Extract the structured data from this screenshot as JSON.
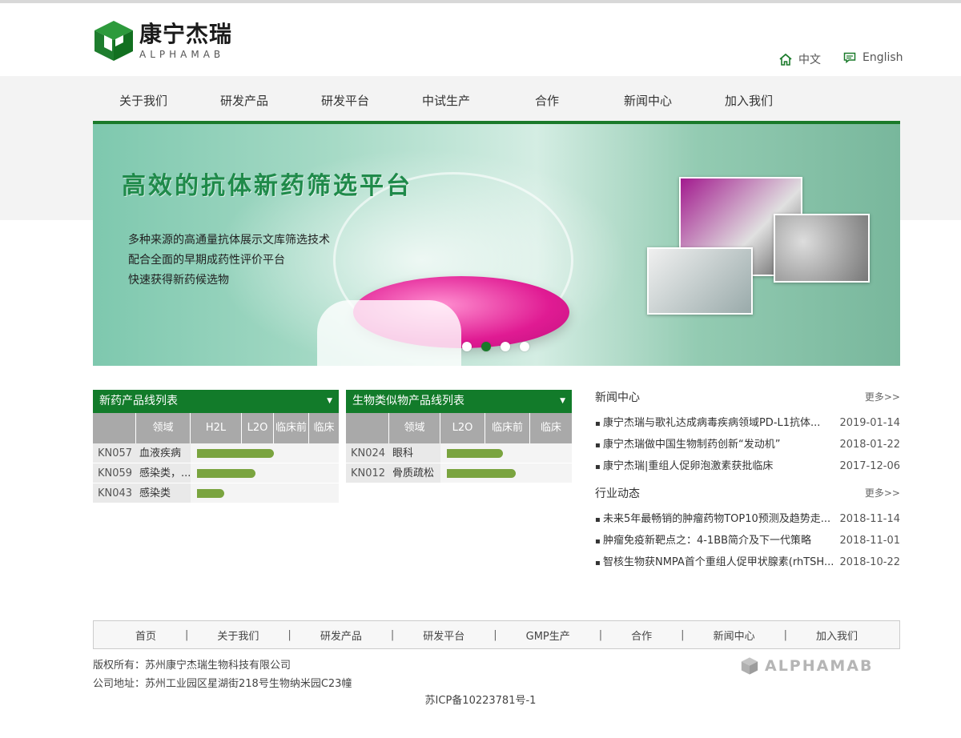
{
  "header": {
    "logo_cn": "康宁杰瑞",
    "logo_en": "ALPHAMAB",
    "lang_cn": "中文",
    "lang_en": "English"
  },
  "nav": [
    "关于我们",
    "研发产品",
    "研发平台",
    "中试生产",
    "合作",
    "新闻中心",
    "加入我们"
  ],
  "banner": {
    "title": "高效的抗体新药筛选平台",
    "lines": [
      "多种来源的高通量抗体展示文库筛选技术",
      "配合全面的早期成药性评价平台",
      "快速获得新药候选物"
    ],
    "active_dot": 1
  },
  "new_drugs": {
    "title": "新药产品线列表",
    "columns": [
      "",
      "领域",
      "H2L",
      "L2O",
      "临床前",
      "临床"
    ],
    "rows": [
      {
        "code": "KN057",
        "field": "血液疾病",
        "progress": 0.54
      },
      {
        "code": "KN059",
        "field": "感染类，...",
        "progress": 0.41
      },
      {
        "code": "KN043",
        "field": "感染类",
        "progress": 0.19
      }
    ]
  },
  "biosimilars": {
    "title": "生物类似物产品线列表",
    "columns": [
      "",
      "领域",
      "L2O",
      "临床前",
      "临床"
    ],
    "rows": [
      {
        "code": "KN024",
        "field": "眼科",
        "progress": 0.45
      },
      {
        "code": "KN012",
        "field": "骨质疏松",
        "progress": 0.55
      }
    ]
  },
  "news_center": {
    "title": "新闻中心",
    "more": "更多>>",
    "items": [
      {
        "title": "康宁杰瑞与歌礼达成病毒疾病领域PD-L1抗体...",
        "date": "2019-01-14"
      },
      {
        "title": "康宁杰瑞做中国生物制药创新“发动机”",
        "date": "2018-01-22"
      },
      {
        "title": "康宁杰瑞|重组人促卵泡激素获批临床",
        "date": "2017-12-06"
      }
    ]
  },
  "industry": {
    "title": "行业动态",
    "more": "更多>>",
    "items": [
      {
        "title": "未来5年最畅销的肿瘤药物TOP10预测及趋势走...",
        "date": "2018-11-14"
      },
      {
        "title": "肿瘤免疫新靶点之：4-1BB简介及下一代策略",
        "date": "2018-11-01"
      },
      {
        "title": "智核生物获NMPA首个重组人促甲状腺素(rhTSH...",
        "date": "2018-10-22"
      }
    ]
  },
  "footer": {
    "nav": [
      "首页",
      "关于我们",
      "研发产品",
      "研发平台",
      "GMP生产",
      "合作",
      "新闻中心",
      "加入我们"
    ],
    "copyright": "版权所有：苏州康宁杰瑞生物科技有限公司",
    "address": "公司地址：苏州工业园区星湖街218号生物纳米园C23幢",
    "icp": "苏ICP备10223781号-1",
    "logo_text": "ALPHAMAB"
  },
  "colors": {
    "brand_green": "#127b2a",
    "bar_green": "#7aa43f",
    "header_gray": "#a9a9a9"
  }
}
